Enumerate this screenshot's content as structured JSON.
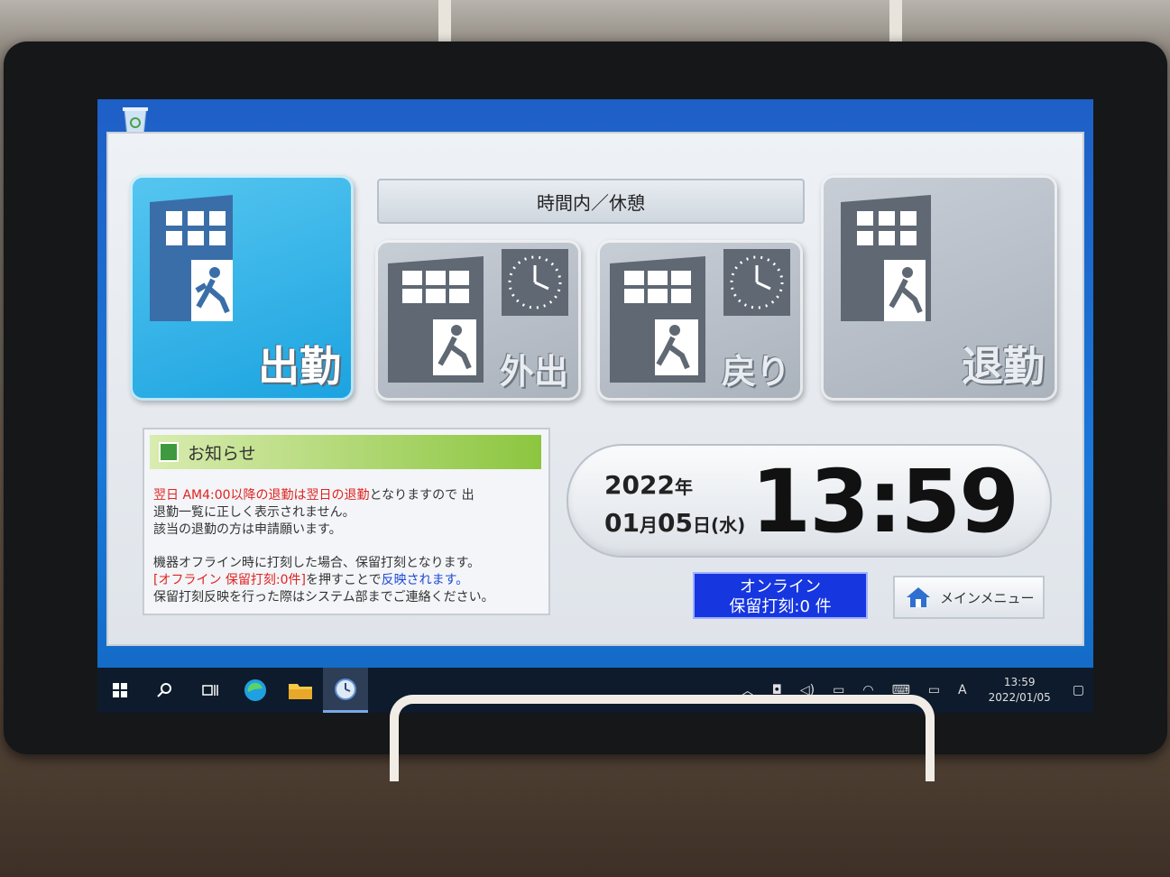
{
  "status_bar": "時間内／休憩",
  "tiles": {
    "clock_in": "出勤",
    "go_out": "外出",
    "return": "戻り",
    "clock_out": "退勤"
  },
  "notice": {
    "title": "お知らせ",
    "line1_red": "翌日 AM4:00以降の退勤は翌日の退勤",
    "line1_rest": "となりますので 出",
    "line2": "退勤一覧に正しく表示されません。",
    "line3": "該当の退勤の方は申請願います。",
    "line4": "機器オフライン時に打刻した場合、保留打刻となります。",
    "line5_red": "[オフライン 保留打刻:0件]",
    "line5_mid": "を押すことで",
    "line5_blue": "反映されます。",
    "line6": "保留打刻反映を行った際はシステム部までご連絡ください。"
  },
  "clock": {
    "year": "2022",
    "year_unit": "年",
    "month": "01",
    "month_unit": "月",
    "day": "05",
    "day_unit": "日",
    "weekday": "(水)",
    "time": "13:59"
  },
  "online_button": {
    "line1": "オンライン",
    "line2": "保留打刻:0 件"
  },
  "menu_button": "メインメニュー",
  "taskbar": {
    "tray_ime": "A",
    "time": "13:59",
    "date": "2022/01/05"
  }
}
